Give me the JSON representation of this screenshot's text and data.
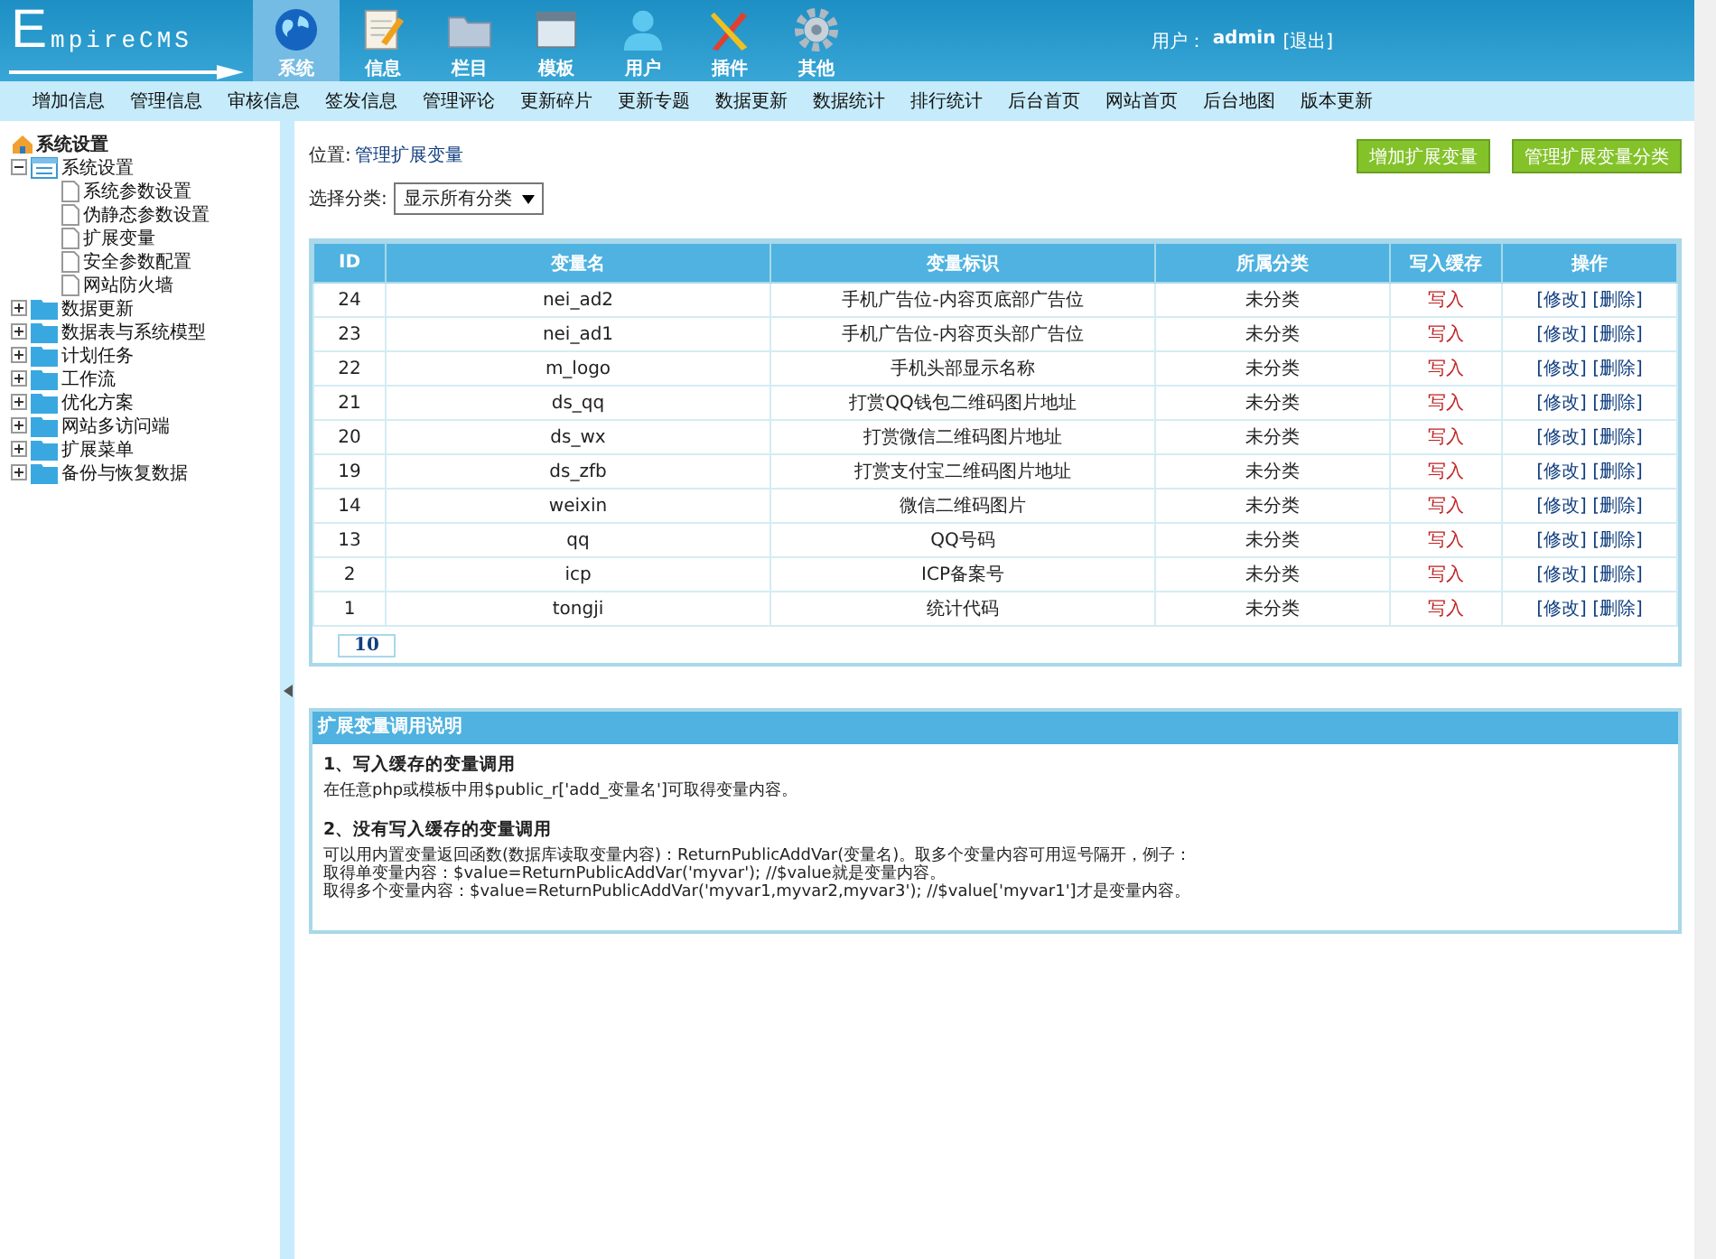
{
  "header": {
    "logo": "EmpireCMS",
    "nav": [
      {
        "label": "系统",
        "kind": "globe",
        "selected": true
      },
      {
        "label": "信息",
        "kind": "notepad",
        "selected": false
      },
      {
        "label": "栏目",
        "kind": "folder",
        "selected": false
      },
      {
        "label": "模板",
        "kind": "window",
        "selected": false
      },
      {
        "label": "用户",
        "kind": "user",
        "selected": false
      },
      {
        "label": "插件",
        "kind": "tools",
        "selected": false
      },
      {
        "label": "其他",
        "kind": "gear",
        "selected": false
      }
    ],
    "user_label": "用户：",
    "user_name": "admin",
    "logout": "[退出]"
  },
  "submenu": [
    "增加信息",
    "管理信息",
    "审核信息",
    "签发信息",
    "管理评论",
    "更新碎片",
    "更新专题",
    "数据更新",
    "数据统计",
    "排行统计",
    "后台首页",
    "网站首页",
    "后台地图",
    "版本更新"
  ],
  "sidebar": {
    "root": "系统设置",
    "items": [
      {
        "label": "系统设置",
        "expanded": true,
        "children": [
          {
            "label": "系统参数设置"
          },
          {
            "label": "伪静态参数设置"
          },
          {
            "label": "扩展变量"
          },
          {
            "label": "安全参数配置"
          },
          {
            "label": "网站防火墙"
          }
        ]
      },
      {
        "label": "数据更新",
        "expanded": false
      },
      {
        "label": "数据表与系统模型",
        "expanded": false
      },
      {
        "label": "计划任务",
        "expanded": false
      },
      {
        "label": "工作流",
        "expanded": false
      },
      {
        "label": "优化方案",
        "expanded": false
      },
      {
        "label": "网站多访问端",
        "expanded": false
      },
      {
        "label": "扩展菜单",
        "expanded": false
      },
      {
        "label": "备份与恢复数据",
        "expanded": false
      }
    ]
  },
  "content": {
    "location_label": "位置:",
    "location": "管理扩展变量",
    "buttons": [
      "增加扩展变量",
      "管理扩展变量分类"
    ],
    "filter_label": "选择分类:",
    "filter_value": "显示所有分类",
    "table": {
      "columns": [
        "ID",
        "变量名",
        "变量标识",
        "所属分类",
        "写入缓存",
        "操作"
      ],
      "rows": [
        {
          "id": "24",
          "name": "nei_ad2",
          "mark": "手机广告位-内容页底部广告位",
          "category": "未分类",
          "cache": "写入",
          "edit": "[修改]",
          "delete": "[删除]"
        },
        {
          "id": "23",
          "name": "nei_ad1",
          "mark": "手机广告位-内容页头部广告位",
          "category": "未分类",
          "cache": "写入",
          "edit": "[修改]",
          "delete": "[删除]"
        },
        {
          "id": "22",
          "name": "m_logo",
          "mark": "手机头部显示名称",
          "category": "未分类",
          "cache": "写入",
          "edit": "[修改]",
          "delete": "[删除]"
        },
        {
          "id": "21",
          "name": "ds_qq",
          "mark": "打赏QQ钱包二维码图片地址",
          "category": "未分类",
          "cache": "写入",
          "edit": "[修改]",
          "delete": "[删除]"
        },
        {
          "id": "20",
          "name": "ds_wx",
          "mark": "打赏微信二维码图片地址",
          "category": "未分类",
          "cache": "写入",
          "edit": "[修改]",
          "delete": "[删除]"
        },
        {
          "id": "19",
          "name": "ds_zfb",
          "mark": "打赏支付宝二维码图片地址",
          "category": "未分类",
          "cache": "写入",
          "edit": "[修改]",
          "delete": "[删除]"
        },
        {
          "id": "14",
          "name": "weixin",
          "mark": "微信二维码图片",
          "category": "未分类",
          "cache": "写入",
          "edit": "[修改]",
          "delete": "[删除]"
        },
        {
          "id": "13",
          "name": "qq",
          "mark": "QQ号码",
          "category": "未分类",
          "cache": "写入",
          "edit": "[修改]",
          "delete": "[删除]"
        },
        {
          "id": "2",
          "name": "icp",
          "mark": "ICP备案号",
          "category": "未分类",
          "cache": "写入",
          "edit": "[修改]",
          "delete": "[删除]"
        },
        {
          "id": "1",
          "name": "tongji",
          "mark": "统计代码",
          "category": "未分类",
          "cache": "写入",
          "edit": "[修改]",
          "delete": "[删除]"
        }
      ],
      "page": "10"
    },
    "help": {
      "title": "扩展变量调用说明",
      "sections": [
        {
          "heading": "1、写入缓存的变量调用",
          "lines": [
            "在任意php或模板中用$public_r['add_变量名']可取得变量内容。"
          ]
        },
        {
          "heading": "2、没有写入缓存的变量调用",
          "lines": [
            "可以用内置变量返回函数(数据库读取变量内容)：ReturnPublicAddVar(变量名)。取多个变量内容可用逗号隔开，例子：",
            "取得单变量内容：$value=ReturnPublicAddVar('myvar'); //$value就是变量内容。",
            "取得多个变量内容：$value=ReturnPublicAddVar('myvar1,myvar2,myvar3'); //$value['myvar1']才是变量内容。"
          ]
        }
      ]
    }
  }
}
